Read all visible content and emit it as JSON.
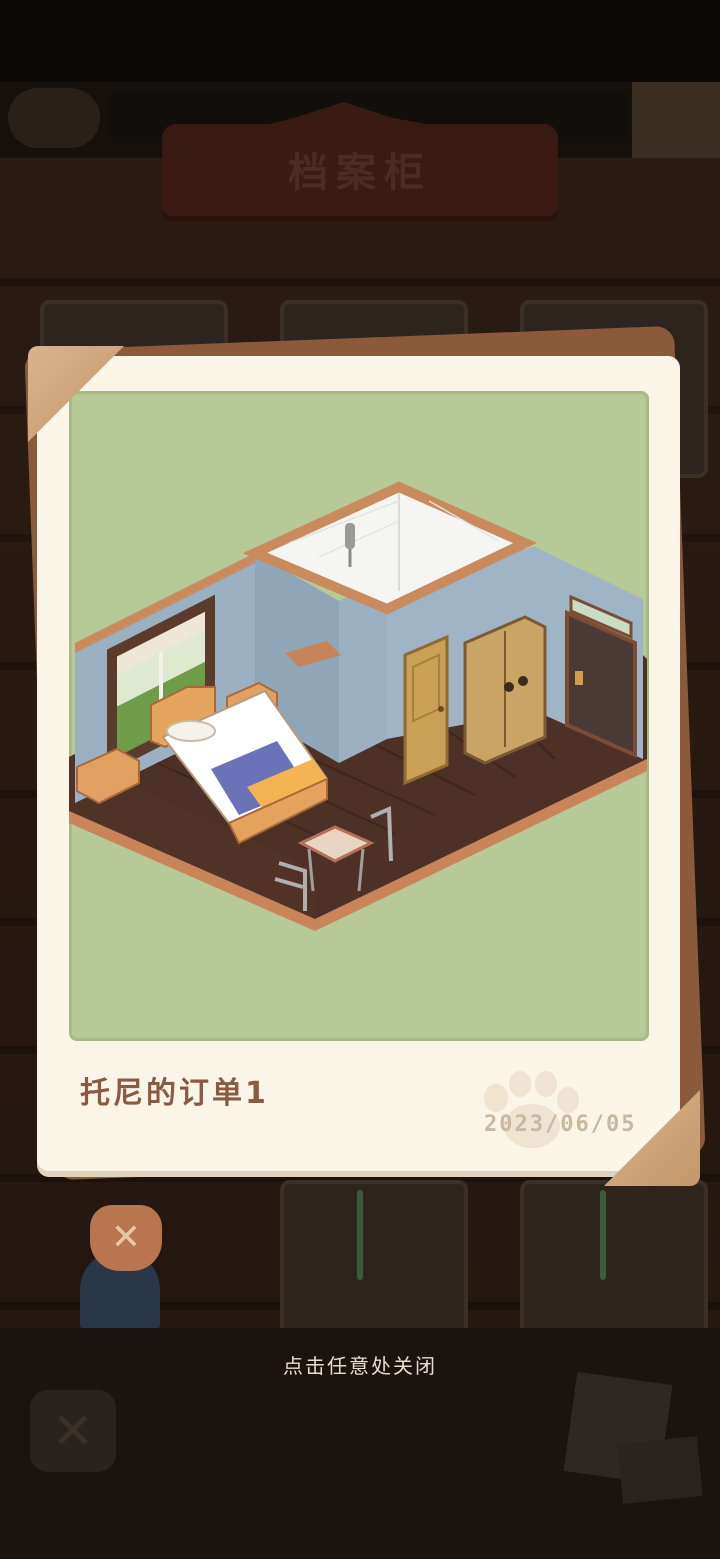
{
  "background": {
    "header_title": "档案柜",
    "dismiss_icon": "close-x-icon"
  },
  "modal": {
    "photo_title": "托尼的订单1",
    "photo_date": "2023/06/05",
    "scene_icon": "isometric-bedroom-illustration",
    "watermark_icon": "paw-print-icon"
  },
  "hint_text": "点击任意处关闭",
  "colors": {
    "card": "#fbf5e8",
    "photo_bg": "#b6c996",
    "title": "#8b5a40",
    "date": "#c8b8a2",
    "corner": "#d1a67c"
  }
}
